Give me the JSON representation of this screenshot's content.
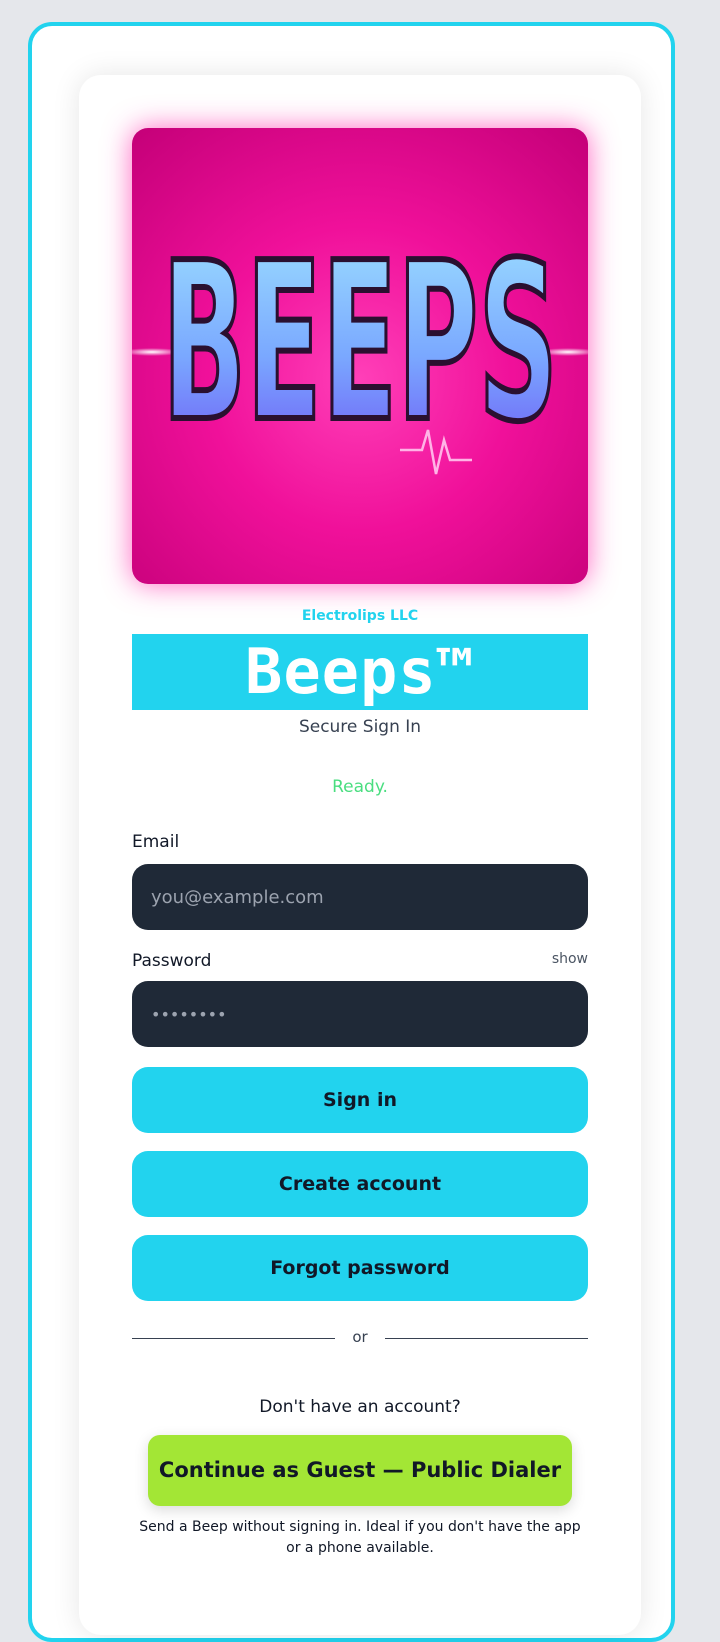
{
  "app": {
    "company": "Electrolips LLC",
    "title": "Beeps™",
    "subtitle": "Secure Sign In",
    "status": "Ready.",
    "logo_text": "BEEPS"
  },
  "form": {
    "email_label": "Email",
    "email_placeholder": "you@example.com",
    "password_label": "Password",
    "password_toggle": "show",
    "password_value": "••••••••"
  },
  "buttons": {
    "sign_in": "Sign in",
    "create_account": "Create account",
    "forgot_password": "Forgot password"
  },
  "divider": "or",
  "guest": {
    "prompt": "Don't have an account?",
    "button": "Continue as Guest — Public Dialer",
    "note": "Send a Beep without signing in. Ideal if you don't have the app or a phone available."
  },
  "colors": {
    "accent": "#22d3ee",
    "guest_button": "#a3e635",
    "status": "#4ade80",
    "input_bg": "#1f2937"
  }
}
